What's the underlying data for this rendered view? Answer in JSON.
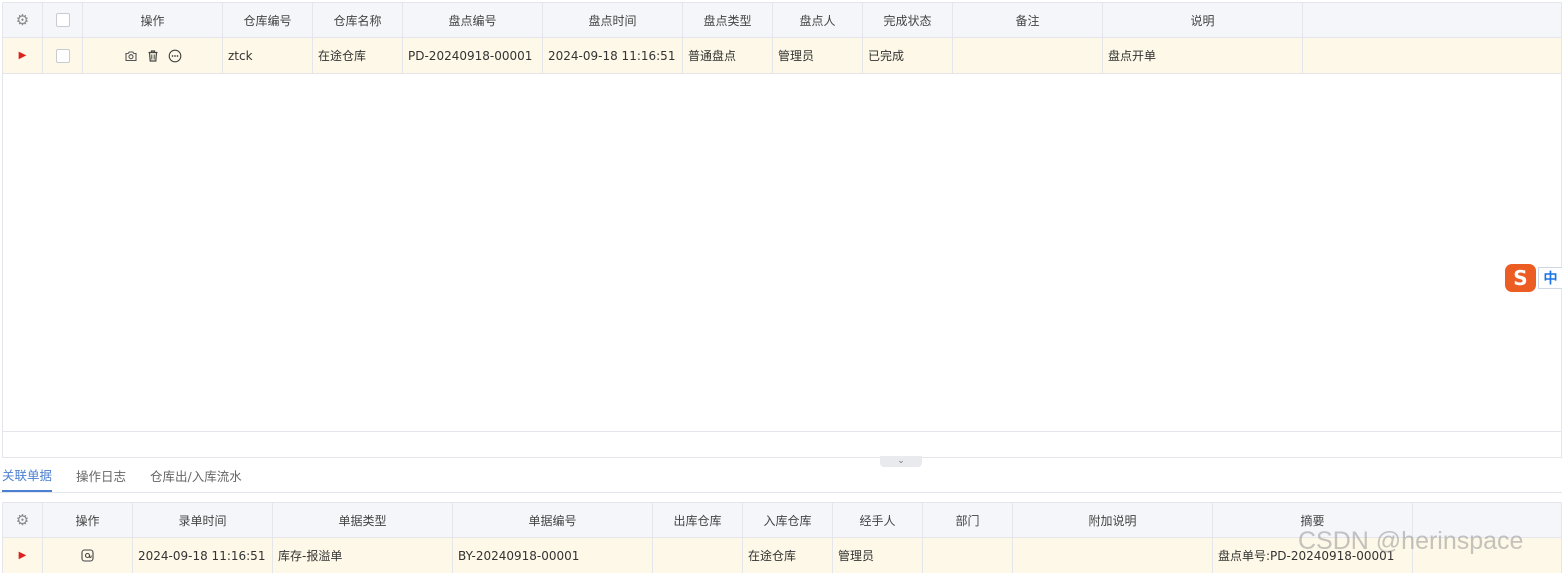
{
  "top_grid": {
    "headers": [
      "操作",
      "仓库编号",
      "仓库名称",
      "盘点编号",
      "盘点时间",
      "盘点类型",
      "盘点人",
      "完成状态",
      "备注",
      "说明"
    ],
    "row": {
      "warehouse_code": "ztck",
      "warehouse_name": "在途仓库",
      "count_no": "PD-20240918-00001",
      "count_time": "2024-09-18 11:16:51",
      "count_type": "普通盘点",
      "counter": "管理员",
      "status": "已完成",
      "remark": "",
      "description": "盘点开单"
    },
    "row_icons": [
      "camera-icon",
      "trash-icon",
      "more-icon"
    ]
  },
  "tabs": [
    "关联单据",
    "操作日志",
    "仓库出/入库流水"
  ],
  "active_tab": 0,
  "bottom_grid": {
    "headers": [
      "操作",
      "录单时间",
      "单据类型",
      "单据编号",
      "出库仓库",
      "入库仓库",
      "经手人",
      "部门",
      "附加说明",
      "摘要"
    ],
    "row": {
      "record_time": "2024-09-18 11:16:51",
      "doc_type": "库存-报溢单",
      "doc_no": "BY-20240918-00001",
      "out_warehouse": "",
      "in_warehouse": "在途仓库",
      "handler": "管理员",
      "department": "",
      "note": "",
      "summary": "盘点单号:PD-20240918-00001"
    }
  },
  "ime": {
    "logo": "S",
    "mode": "中"
  },
  "watermark": "CSDN @herinspace",
  "colors": {
    "row_highlight": "#fdf8e7",
    "header_bg": "#f5f6fa",
    "active_tab": "#4b7fd1",
    "marker": "#e02020"
  }
}
